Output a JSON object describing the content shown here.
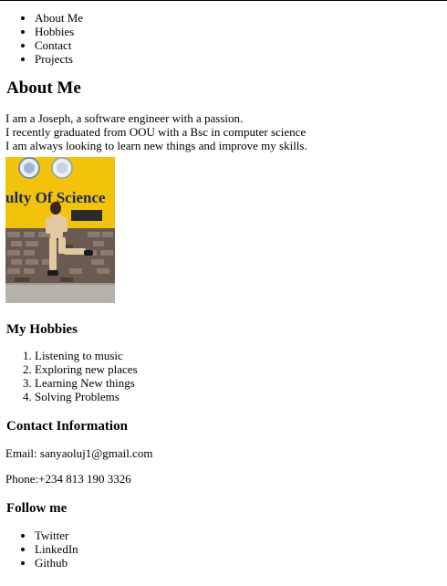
{
  "nav": {
    "items": [
      "About Me",
      "Hobbies",
      "Contact",
      "Projects"
    ]
  },
  "about": {
    "heading": "About Me",
    "lines": [
      "I am a Joseph, a software engineer with a passion.",
      "I recently graduated from OOU with a Bsc in computer science",
      "I am always looking to learn new things and improve my skills."
    ],
    "photo_sign_text": "ulty Of Science"
  },
  "hobbies": {
    "heading": "My Hobbies",
    "items": [
      "Listening to music",
      "Exploring new places",
      "Learning New things",
      "Solving Problems"
    ]
  },
  "contact": {
    "heading": "Contact Information",
    "email": "Email: sanyaoluj1@gmail.com",
    "phone": "Phone:+234 813 190 3326"
  },
  "follow": {
    "heading": "Follow me",
    "items": [
      "Twitter",
      "LinkedIn",
      "Github"
    ]
  }
}
